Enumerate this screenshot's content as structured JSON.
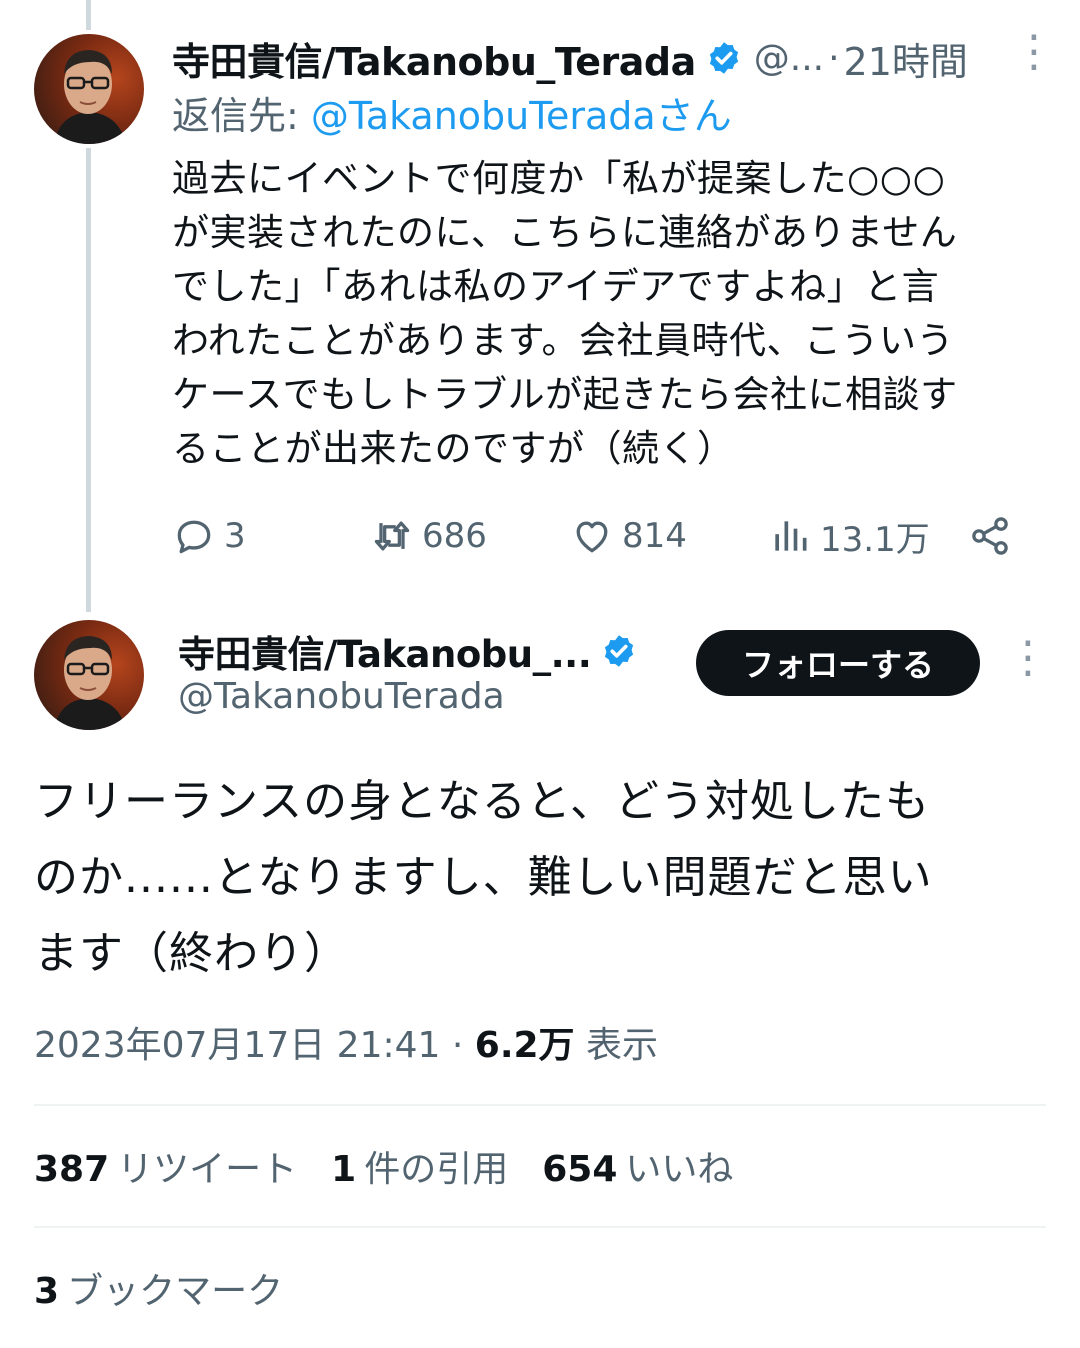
{
  "colors": {
    "accent": "#1d9bf0",
    "text": "#0f1419",
    "muted": "#536471",
    "verified": "#1d9bf0"
  },
  "reply_tweet": {
    "author_name": "寺田貴信/Takanobu_Terada",
    "handle": "@...",
    "separator": "·",
    "time": "21時間",
    "replying_label": "返信先: ",
    "replying_to": "@TakanobuTeradaさん",
    "text_lines": [
      "過去にイベントで何度か「私が提案した○○○",
      "が実装されたのに、こちらに連絡がありません",
      "でした」「あれは私のアイデアですよね」と言",
      "われたことがあります。会社員時代、こういう",
      "ケースでもしトラブルが起きたら会社に相談す",
      "ることが出来たのですが（続く）"
    ],
    "actions": {
      "reply_count": "3",
      "retweet_count": "686",
      "like_count": "814",
      "views_count": "13.1万"
    }
  },
  "main_tweet": {
    "author_name": "寺田貴信/Takanobu_...",
    "handle": "@TakanobuTerada",
    "follow_label": "フォローする",
    "text_lines": [
      "フリーランスの身となると、どう対処したも",
      "のか......となりますし、難しい問題だと思い",
      "ます（終わり）"
    ],
    "timestamp": "2023年07月17日 21:41",
    "separator": " · ",
    "views_value": "6.2万",
    "views_label": " 表示",
    "stats": {
      "retweets_value": "387",
      "retweets_label": "リツイート",
      "quotes_value": "1",
      "quotes_label": "件の引用",
      "likes_value": "654",
      "likes_label": "いいね",
      "bookmarks_value": "3",
      "bookmarks_label": "ブックマーク"
    }
  },
  "icons": [
    "verified-badge-icon",
    "more-options-icon",
    "reply-icon",
    "retweet-icon",
    "like-icon",
    "views-icon",
    "share-icon"
  ]
}
